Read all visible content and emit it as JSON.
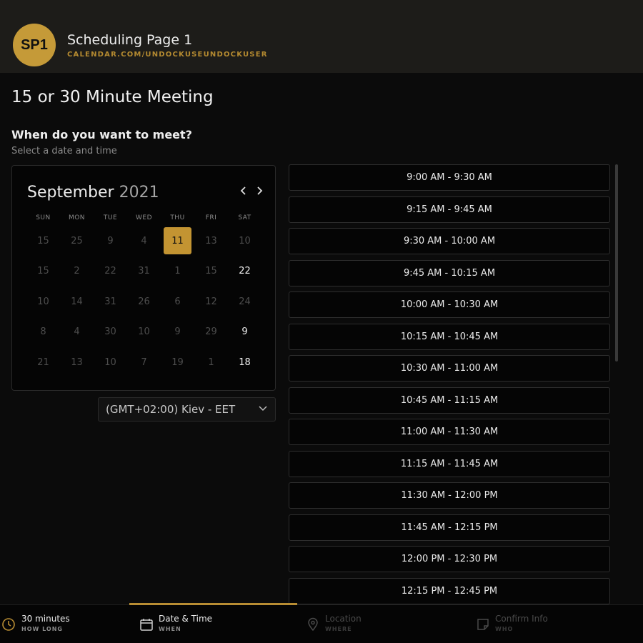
{
  "header": {
    "avatar_initials": "SP1",
    "title": "Scheduling Page 1",
    "url": "CALENDAR.COM/UNDOCKUSEUNDOCKUSER",
    "accent_color": "#c59a38"
  },
  "page_title": "15 or 30 Minute Meeting",
  "question": "When do you want to meet?",
  "subquestion": "Select a date and time",
  "calendar": {
    "month": "September",
    "year": "2021",
    "days_of_week": [
      "SUN",
      "MON",
      "TUE",
      "WED",
      "THU",
      "FRI",
      "SAT"
    ],
    "weeks": [
      [
        "15",
        "25",
        "9",
        "4",
        "11",
        "13",
        "10"
      ],
      [
        "15",
        "2",
        "22",
        "31",
        "1",
        "15",
        "22"
      ],
      [
        "10",
        "14",
        "31",
        "26",
        "6",
        "12",
        "24"
      ],
      [
        "8",
        "4",
        "30",
        "10",
        "9",
        "29",
        "9"
      ],
      [
        "21",
        "13",
        "10",
        "7",
        "19",
        "1",
        "18"
      ]
    ],
    "selected": [
      0,
      4
    ],
    "available": [
      [
        1,
        6
      ],
      [
        3,
        6
      ],
      [
        4,
        6
      ]
    ]
  },
  "timezone": "(GMT+02:00) Kiev - EET",
  "time_slots": [
    "9:00 AM - 9:30 AM",
    "9:15 AM - 9:45 AM",
    "9:30 AM - 10:00 AM",
    "9:45 AM - 10:15 AM",
    "10:00 AM - 10:30 AM",
    "10:15 AM - 10:45 AM",
    "10:30 AM - 11:00 AM",
    "10:45 AM - 11:15 AM",
    "11:00 AM - 11:30 AM",
    "11:15 AM - 11:45 AM",
    "11:30 AM - 12:00 PM",
    "11:45 AM - 12:15 PM",
    "12:00 PM - 12:30 PM",
    "12:15 PM - 12:45 PM"
  ],
  "footer": {
    "steps": [
      {
        "label": "30 minutes",
        "sub": "HOW LONG",
        "icon": "clock-icon"
      },
      {
        "label": "Date & Time",
        "sub": "WHEN",
        "icon": "calendar-icon"
      },
      {
        "label": "Location",
        "sub": "WHERE",
        "icon": "location-pin-icon"
      },
      {
        "label": "Confirm Info",
        "sub": "WHO",
        "icon": "note-icon"
      }
    ],
    "active_step": "Date & Time"
  }
}
